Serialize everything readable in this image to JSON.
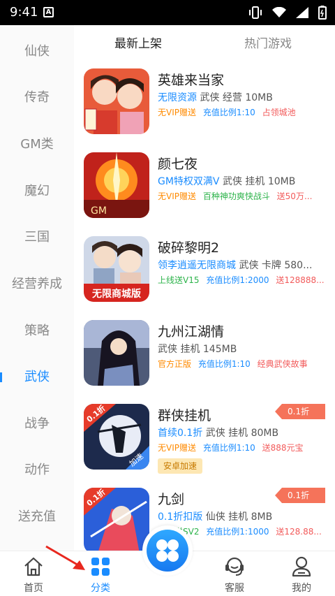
{
  "status_bar": {
    "time": "9:41",
    "sim_label": "A"
  },
  "rail": {
    "items": [
      {
        "label": "仙侠"
      },
      {
        "label": "传奇"
      },
      {
        "label": "GM类"
      },
      {
        "label": "魔幻"
      },
      {
        "label": "三国"
      },
      {
        "label": "经营养成"
      },
      {
        "label": "策略"
      },
      {
        "label": "武侠",
        "active": true
      },
      {
        "label": "战争"
      },
      {
        "label": "动作"
      },
      {
        "label": "送充值"
      }
    ]
  },
  "tabs": [
    {
      "label": "最新上架",
      "active": true
    },
    {
      "label": "热门游戏",
      "active": false
    }
  ],
  "games": [
    {
      "name": "英雄来当家",
      "highlight": "无限资源",
      "meta_rest": " 武侠 经营 10MB",
      "tags": [
        "无VIP赠送",
        "充值比例1:10",
        "占领城池"
      ],
      "icon": "hero-game-icon"
    },
    {
      "name": "颜七夜",
      "highlight": "GM特权双满V",
      "meta_rest": " 武侠 挂机 10MB",
      "tags": [
        "无VIP赠送",
        "百种神功爽快战斗",
        "送50万..."
      ],
      "icon": "yan-game-icon"
    },
    {
      "name": "破碎黎明2",
      "highlight": "领李逍遥无限商城",
      "meta_rest": " 武侠 卡牌 580...",
      "tags": [
        "上线送V15",
        "充值比例1:2000",
        "送128888..."
      ],
      "icon": "dawn-game-icon",
      "icon_text": "无限商城版"
    },
    {
      "name": "九州江湖情",
      "highlight": "",
      "meta_rest": "武侠 挂机 145MB",
      "tags": [
        "官方正版",
        "充值比例1:10",
        "经典武侠故事"
      ],
      "icon": "jiuzhou-game-icon"
    },
    {
      "name": "群侠挂机",
      "highlight": "首续0.1折",
      "meta_rest": " 武侠 挂机 80MB",
      "tags": [
        "无VIP赠送",
        "充值比例1:10",
        "送888元宝"
      ],
      "icon": "qunxia-game-icon",
      "discount": "0.1折",
      "icon_badge": "0.1折",
      "icon_corner": "加速",
      "accel_label": "安卓加速"
    },
    {
      "name": "九剑",
      "highlight": "0.1折扣版",
      "meta_rest": " 仙侠 挂机 8MB",
      "tags": [
        "上线送SV2",
        "充值比例1:1000",
        "送128.88..."
      ],
      "icon": "jiujian-game-icon",
      "discount": "0.1折",
      "icon_badge": "0.1折"
    }
  ],
  "bottom_nav": [
    {
      "label": "首页",
      "icon": "home-icon"
    },
    {
      "label": "分类",
      "icon": "category-icon",
      "active": true
    },
    {
      "label": "",
      "icon": "center-fab-icon"
    },
    {
      "label": "客服",
      "icon": "headset-icon"
    },
    {
      "label": "我的",
      "icon": "user-icon"
    }
  ],
  "colors": {
    "accent": "#1a8cff",
    "tag_red": "#f25a5a",
    "tag_orange": "#ff8a00",
    "discount": "#f5735a"
  }
}
